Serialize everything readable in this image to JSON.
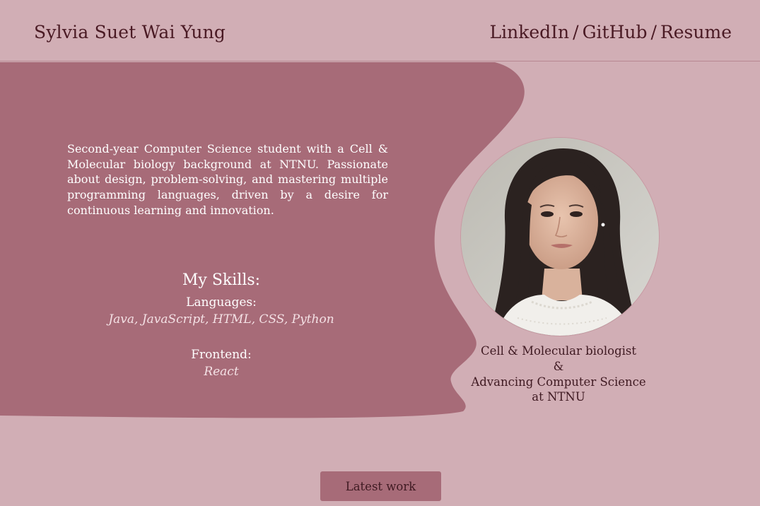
{
  "header": {
    "site_name": "Sylvia Suet Wai Yung",
    "nav": [
      "LinkedIn",
      "GitHub",
      "Resume"
    ],
    "separator": "/"
  },
  "about": {
    "bio": "Second-year Computer Science student with a Cell & Molecular biology background at NTNU. Passionate about design, problem-solving, and mastering multiple programming languages, driven by a desire for continuous learning and innovation."
  },
  "skills": {
    "title": "My Skills:",
    "groups": [
      {
        "label": "Languages:",
        "value": "Java, JavaScript, HTML, CSS, Python"
      },
      {
        "label": "Frontend:",
        "value": "React"
      }
    ]
  },
  "caption": {
    "line1": "Cell & Molecular biologist",
    "line2": "&",
    "line3": "Advancing Computer Science",
    "line4": "at NTNU"
  },
  "cta": {
    "label": "Latest work"
  },
  "colors": {
    "background": "#d1aeb5",
    "panel": "#a76b78",
    "text_dark": "#4a1a24",
    "text_light": "#ffffff"
  }
}
